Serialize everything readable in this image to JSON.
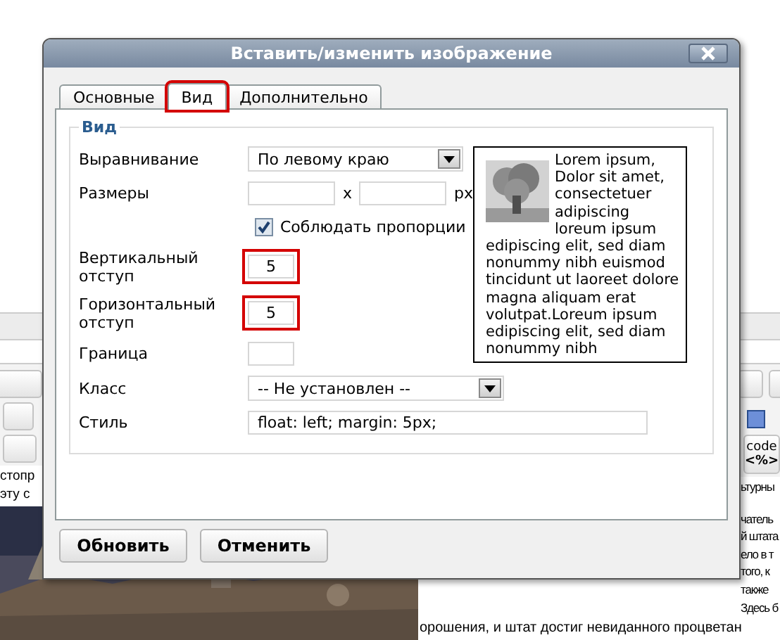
{
  "background": {
    "code_button": [
      "code",
      "<%>"
    ],
    "left_text": [
      "стопр",
      "эту с"
    ],
    "right_text": [
      "ьтурны",
      "чатель",
      "й штата",
      "ело в т",
      "того, к",
      "также",
      "Здесь б"
    ],
    "bottom_text": "орошения, и штат достиг невиданного процветан"
  },
  "dialog": {
    "title": "Вставить/изменить изображение",
    "tabs": [
      {
        "label": "Основные",
        "selected": false,
        "highlighted": false
      },
      {
        "label": "Вид",
        "selected": true,
        "highlighted": true
      },
      {
        "label": "Дополнительно",
        "selected": false,
        "highlighted": false
      }
    ],
    "section": {
      "legend": "Вид",
      "fields": [
        {
          "kind": "select",
          "label": "Выравнивание",
          "value": "По левому краю"
        },
        {
          "kind": "size",
          "label": "Размеры",
          "separator": "x",
          "unit": "px"
        },
        {
          "kind": "checkbox",
          "label": "Соблюдать пропорции",
          "checked": true
        },
        {
          "kind": "input",
          "label": "Вертикальный отступ",
          "value": "5",
          "highlighted": true
        },
        {
          "kind": "input",
          "label": "Горизонтальный отступ",
          "value": "5",
          "highlighted": true
        },
        {
          "kind": "input",
          "label": "Граница",
          "highlighted": false
        },
        {
          "kind": "select",
          "label": "Класс",
          "value": "-- Не установлен --"
        },
        {
          "kind": "text",
          "label": "Стиль",
          "value": "float: left; margin: 5px;"
        }
      ],
      "preview": {
        "beside_image": "Lorem ipsum, Dolor sit amet, consectetuer adipiscing loreum ipsum",
        "below_image": "edipiscing elit, sed diam nonummy nibh euismod tincidunt ut laoreet dolore magna aliquam erat volutpat.Loreum ipsum edipiscing elit, sed diam nonummy nibh"
      }
    },
    "buttons": [
      "Обновить",
      "Отменить"
    ]
  }
}
